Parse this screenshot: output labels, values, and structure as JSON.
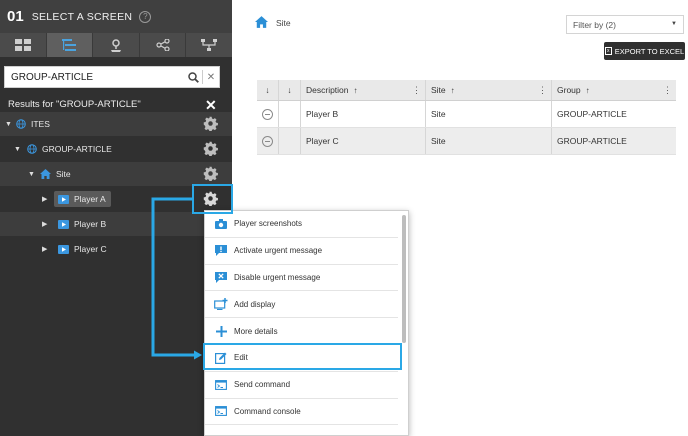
{
  "header": {
    "step": "01",
    "title": "SELECT A SCREEN",
    "help_icon": "help-circle-icon"
  },
  "view_tabs": [
    {
      "icon": "grid-view-icon"
    },
    {
      "icon": "tree-list-icon",
      "active": true
    },
    {
      "icon": "location-pin-icon"
    },
    {
      "icon": "share-network-icon"
    },
    {
      "icon": "hierarchy-icon"
    }
  ],
  "search": {
    "value": "GROUP-ARTICLE",
    "placeholder": ""
  },
  "results": {
    "label": "Results for \"GROUP-ARTICLE\""
  },
  "tree": {
    "ites": "ITES",
    "group": "GROUP-ARTICLE",
    "site": "Site",
    "players": [
      "Player A",
      "Player B",
      "Player C"
    ]
  },
  "breadcrumb": {
    "label": "Site"
  },
  "filter": {
    "label": "Filter by (2)"
  },
  "export": {
    "label": "EXPORT TO EXCEL"
  },
  "grid": {
    "columns": [
      "Description",
      "Site",
      "Group"
    ],
    "sort_marker": "↑",
    "down_marker": "↓",
    "rows": [
      {
        "description": "Player B",
        "site": "Site",
        "group": "GROUP-ARTICLE"
      },
      {
        "description": "Player C",
        "site": "Site",
        "group": "GROUP-ARTICLE"
      }
    ]
  },
  "menu": {
    "items": [
      {
        "label": "Player screenshots",
        "icon": "camera-icon"
      },
      {
        "label": "Activate urgent message",
        "icon": "alert-message-icon"
      },
      {
        "label": "Disable urgent message",
        "icon": "disable-message-icon"
      },
      {
        "label": "Add display",
        "icon": "add-display-icon"
      },
      {
        "label": "More details",
        "icon": "plus-icon"
      },
      {
        "label": "Edit",
        "icon": "edit-icon"
      },
      {
        "label": "Send command",
        "icon": "terminal-icon"
      },
      {
        "label": "Command console",
        "icon": "console-icon"
      }
    ]
  },
  "colors": {
    "accent": "#2aa8e6",
    "sidebar": "#303030",
    "header": "#404040",
    "icon_blue": "#2b8fd6"
  }
}
